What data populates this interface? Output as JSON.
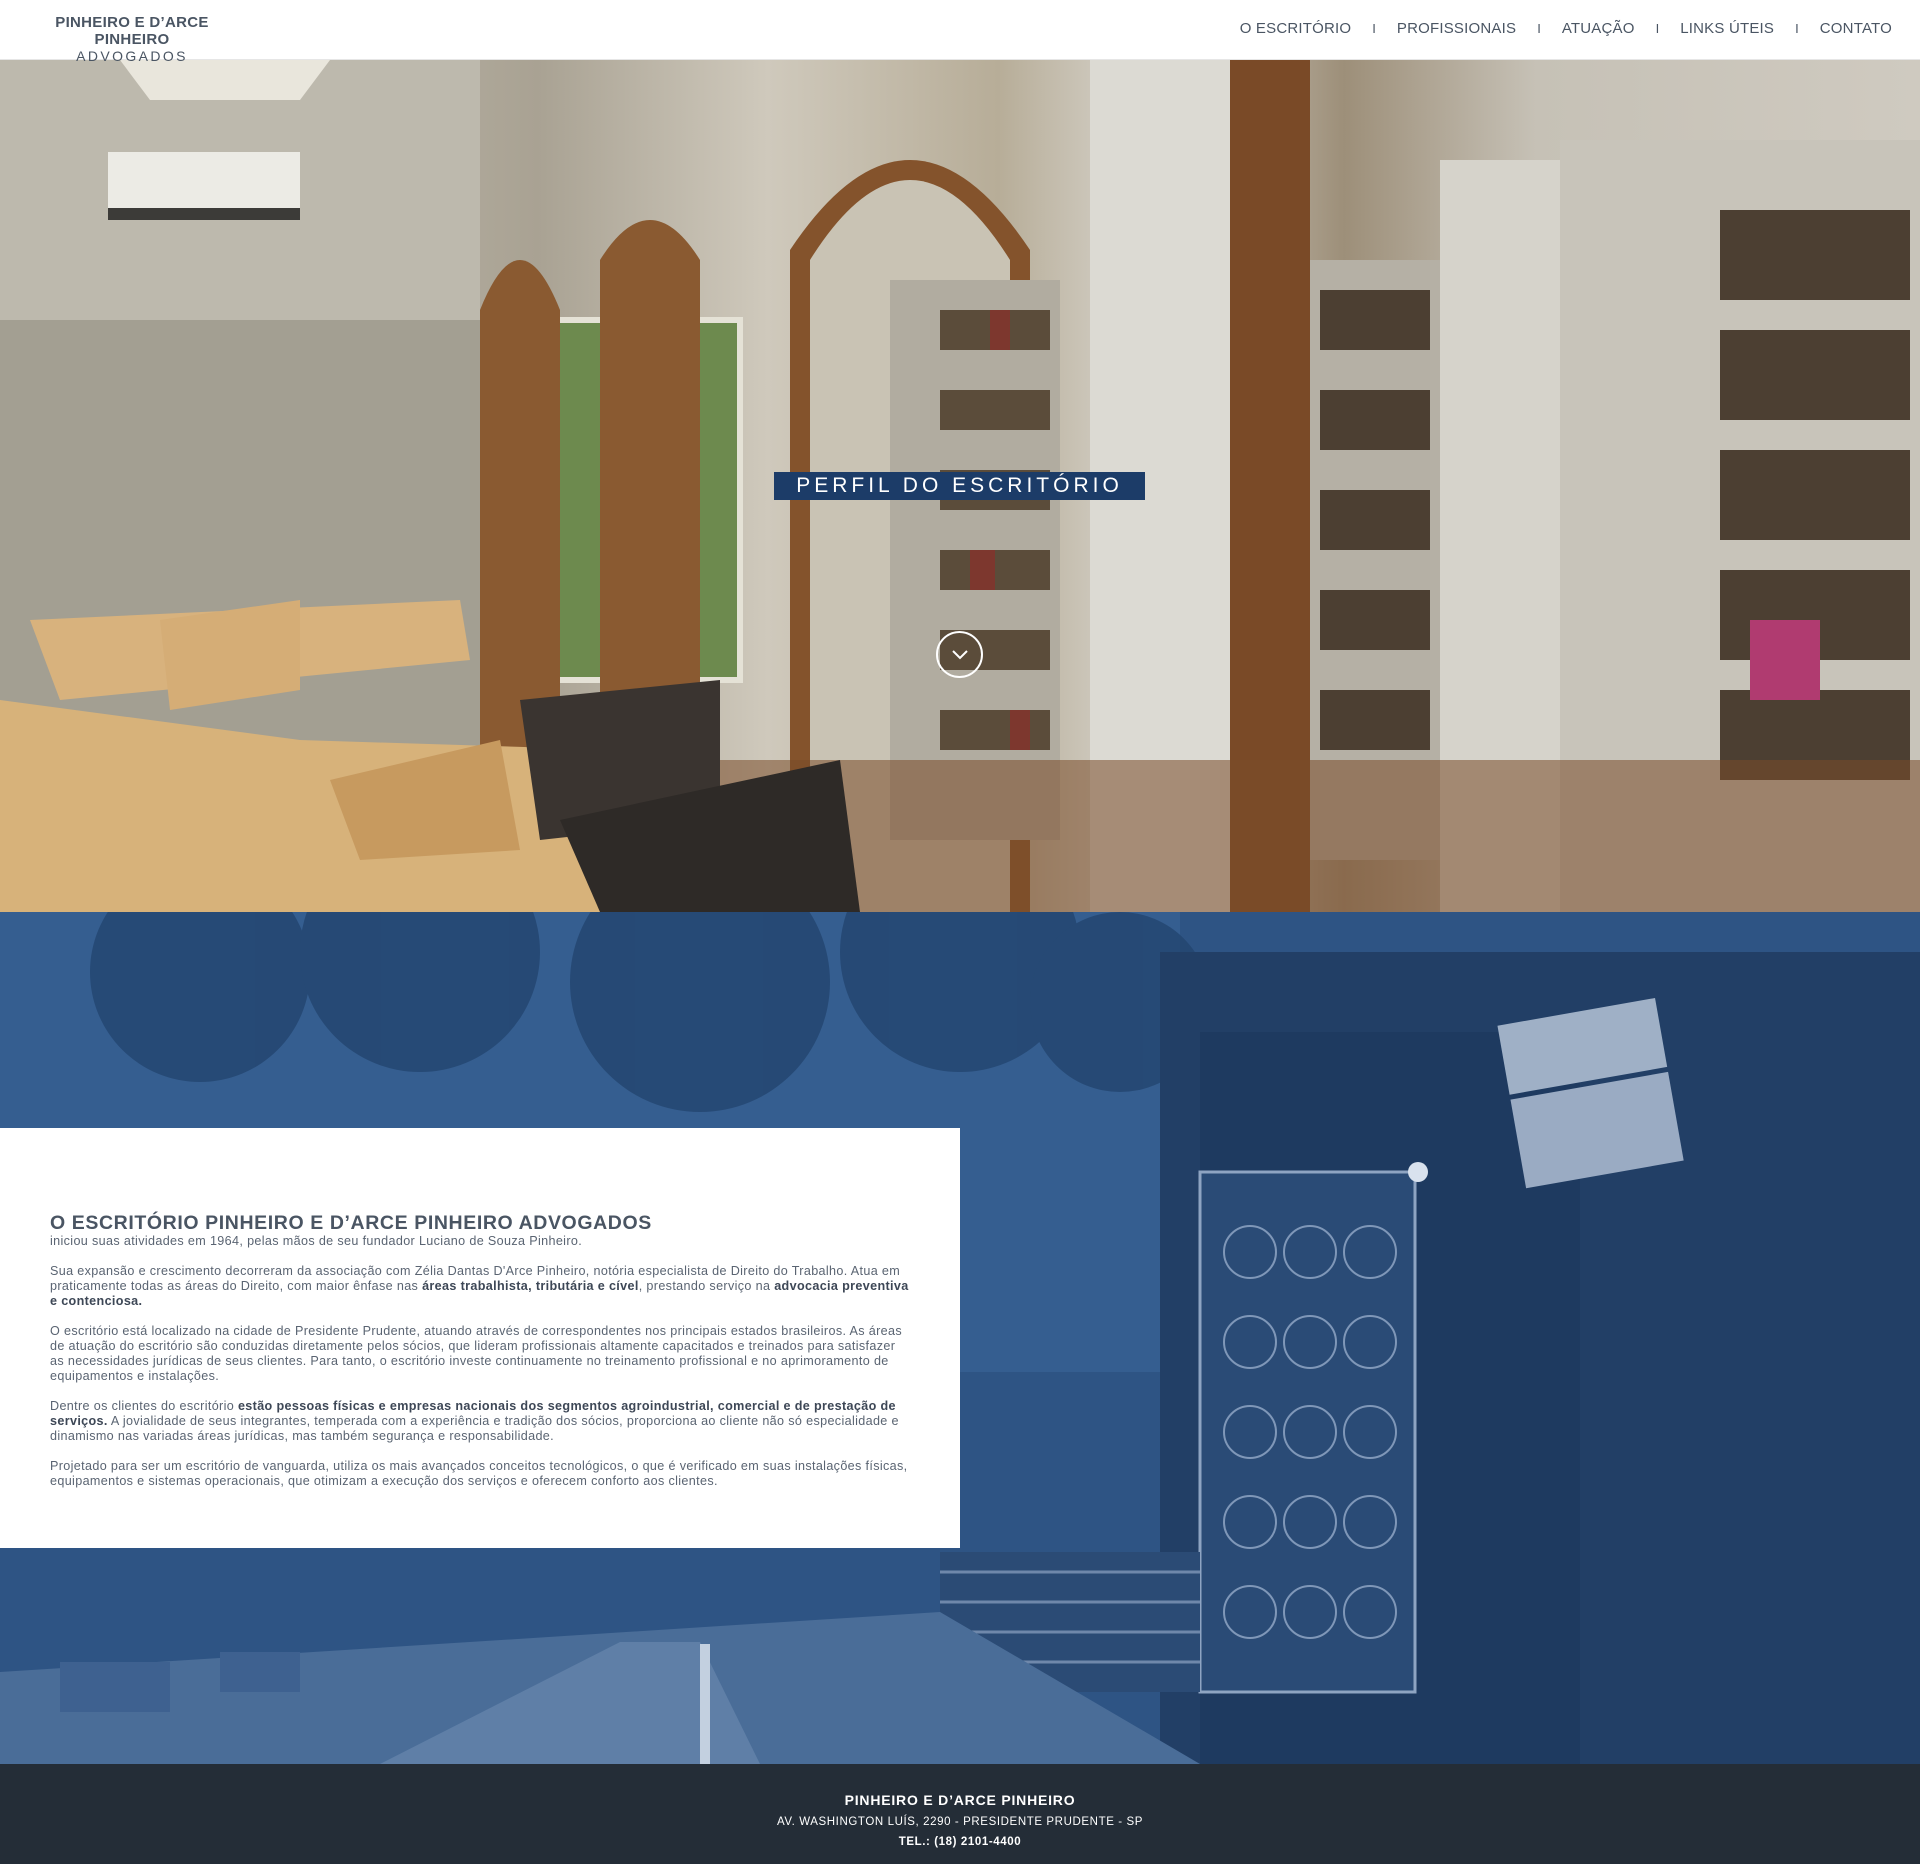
{
  "header": {
    "logo_line1": "PINHEIRO E D’ARCE PINHEIRO",
    "logo_line2": "ADVOGADOS",
    "nav": [
      {
        "label": "O ESCRITÓRIO"
      },
      {
        "label": "PROFISSIONAIS"
      },
      {
        "label": "ATUAÇÃO"
      },
      {
        "label": "LINKS ÚTEIS"
      },
      {
        "label": "CONTATO"
      }
    ],
    "separator": "I"
  },
  "hero": {
    "title": "PERFIL DO ESCRITÓRIO",
    "scroll_icon": "chevron-down-circle-icon"
  },
  "about": {
    "heading": "O ESCRITÓRIO PINHEIRO E D’ARCE PINHEIRO ADVOGADOS",
    "p1": "iniciou suas atividades em 1964, pelas mãos de seu fundador Luciano de Souza Pinheiro.",
    "p2_a": "Sua expansão e crescimento decorreram da associação com Zélia Dantas D'Arce Pinheiro, notória especialista de Direito do Trabalho. Atua em praticamente todas as áreas do Direito, com maior ênfase nas ",
    "p2_b": "áreas trabalhista, tributária e cível",
    "p2_c": ", prestando serviço na ",
    "p2_d": "advocacia preventiva e contenciosa.",
    "p3": "O escritório está localizado na cidade de Presidente Prudente, atuando através de correspondentes nos principais estados brasileiros. As áreas de atuação do escritório são conduzidas diretamente pelos sócios, que lideram profissionais altamente capacitados e treinados para satisfazer as necessidades jurídicas de seus clientes. Para tanto, o escritório investe continuamente no treinamento profissional e no aprimoramento de equipamentos e instalações.",
    "p4_a": "Dentre os clientes do escritório ",
    "p4_b": "estão pessoas físicas e empresas nacionais dos segmentos agroindustrial, comercial e de prestação de serviços.",
    "p4_c": " A jovialidade de seus integrantes, temperada com a experiência e tradição dos sócios, proporciona ao cliente não só especialidade e dinamismo nas variadas áreas jurídicas, mas também segurança e responsabilidade.",
    "p5": "Projetado para ser um escritório de vanguarda, utiliza os mais avançados conceitos tecnológicos, o que é verificado em suas instalações físicas, equipamentos e sistemas operacionais, que otimizam a execução dos serviços e oferecem conforto aos clientes.",
    "sign_line1": "PINHEIRO E D'ARCE PINHEIRO",
    "sign_line2": "ADVOGADOS"
  },
  "footer": {
    "name": "PINHEIRO E D’ARCE PINHEIRO",
    "address": "AV. WASHINGTON LUÍS, 2290 - PRESIDENTE PRUDENTE - SP",
    "phone": "TEL.: (18) 2101-4400"
  },
  "colors": {
    "accent": "#1c3c68",
    "overlay_blue": "#2c5180",
    "footer_bg": "#242d37",
    "text": "#4a5563"
  }
}
